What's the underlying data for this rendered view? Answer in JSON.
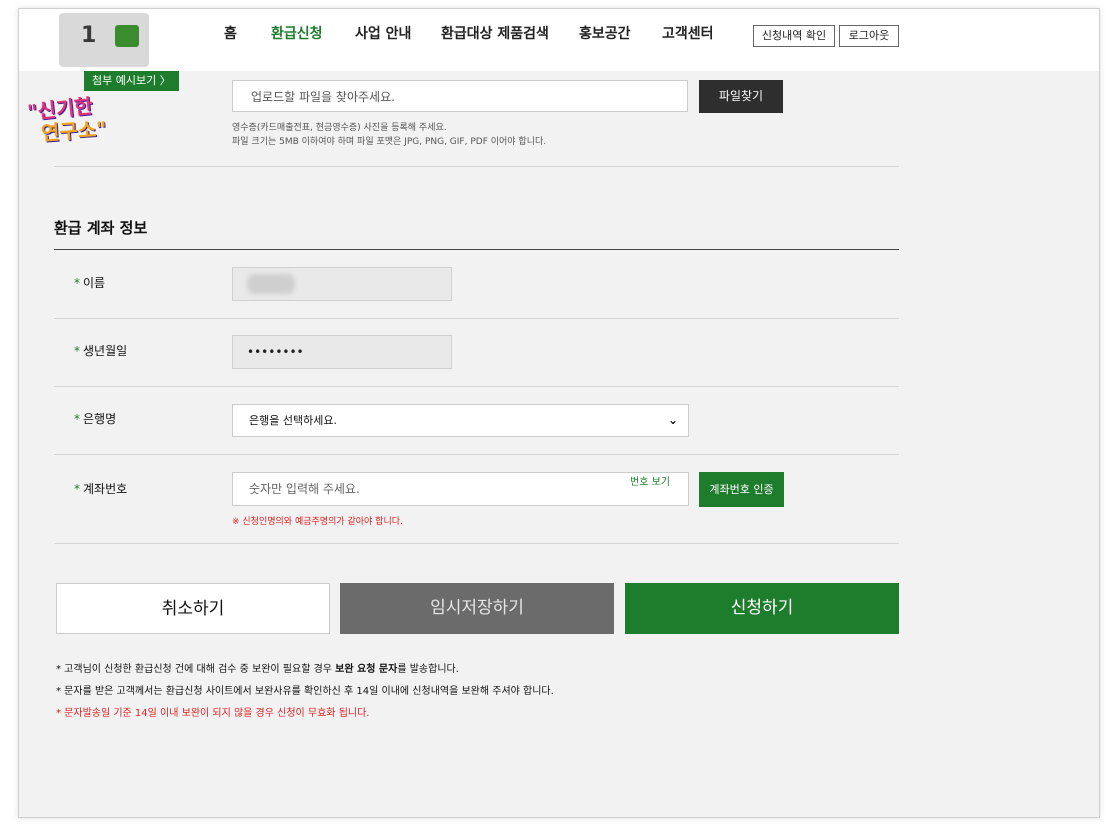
{
  "nav": {
    "items": [
      "홈",
      "환급신청",
      "사업 안내",
      "환급대상 제품검색",
      "홍보공간",
      "고객센터"
    ],
    "active": "환급신청",
    "check_history": "신청내역 확인",
    "logout": "로그아웃"
  },
  "attachment": {
    "example_link": "첨부 예시보기 〉",
    "placeholder": "업로드할 파일을 찾아주세요.",
    "browse_button": "파일찾기",
    "help_line1": "영수증(카드매출전표, 현금영수증) 사진을 등록해 주세요.",
    "help_line2": "파일 크기는 5MB 이하여야 하며 파일 포맷은 JPG, PNG, GIF, PDF 이어야 합니다."
  },
  "side_logo": {
    "line1": "\"신기한",
    "line2": "연구소\""
  },
  "refund_account": {
    "title": "환급 계좌 정보",
    "name_label": "이름",
    "birth_label": "생년월일",
    "birth_value": "••••••••",
    "bank_label": "은행명",
    "bank_placeholder": "은행을 선택하세요.",
    "account_label": "계좌번호",
    "account_placeholder": "숫자만 입력해 주세요.",
    "show_number": "번호 보기",
    "verify_button": "계좌번호 인증",
    "warning": "※ 신청인명의와 예금주명의가 같아야 합니다."
  },
  "actions": {
    "cancel": "취소하기",
    "temp_save": "임시저장하기",
    "submit": "신청하기"
  },
  "notes": {
    "line1_pre": "* 고객님이 신청한 환급신청 건에 대해 검수 중 보완이 필요할 경우 ",
    "line1_bold": "보완 요청 문자",
    "line1_post": "를 발송합니다.",
    "line2": "* 문자를 받은 고객께서는 환급신청 사이트에서 보완사유를 확인하신 후 14일 이내에 신청내역을 보완해 주셔야 합니다.",
    "line3": "* 문자발송일 기준 14일 이내 보완이 되지 않을 경우 신청이 무효화 됩니다."
  },
  "colors": {
    "accent": "#1e7d2c",
    "warning": "#d22222",
    "dark_button": "#2e2e2e"
  }
}
